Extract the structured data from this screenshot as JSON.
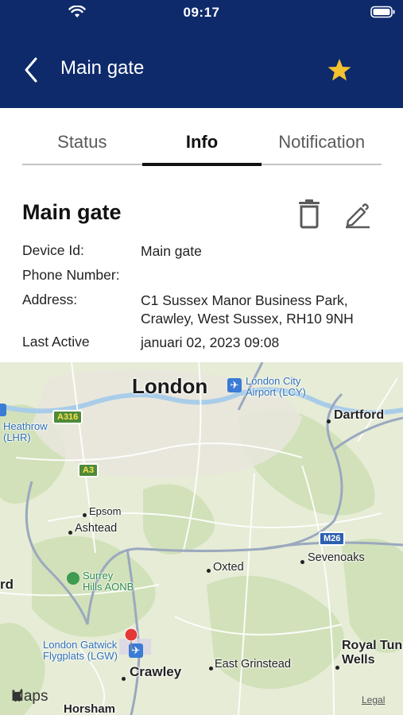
{
  "status_bar": {
    "time": "09:17"
  },
  "nav": {
    "title": "Main gate",
    "favorite_color": "#f2c22f"
  },
  "tabs": [
    {
      "label": "Status",
      "active": false
    },
    {
      "label": "Info",
      "active": true
    },
    {
      "label": "Notification",
      "active": false
    }
  ],
  "device": {
    "title": "Main gate",
    "fields": [
      {
        "label": "Device Id:",
        "value": "Main gate"
      },
      {
        "label": "Phone Number:",
        "value": ""
      },
      {
        "label": "Address:",
        "value_lines": [
          "C1 Sussex Manor Business Park,",
          "Crawley, West Sussex, RH10 9NH"
        ]
      },
      {
        "label": "Last Active",
        "value": "januari 02, 2023 09:08"
      }
    ]
  },
  "map": {
    "labels": {
      "london": "London",
      "london_city_airport": [
        "London City",
        "Airport (LCY)"
      ],
      "heathrow": [
        "Heathrow",
        "(LHR)"
      ],
      "dartford": "Dartford",
      "epsom": "Epsom",
      "ashtead": "Ashtead",
      "surrey_hills": [
        "Surrey",
        "Hills AONB"
      ],
      "oxted": "Oxted",
      "sevenoaks": "Sevenoaks",
      "gatwick": [
        "London Gatwick",
        "Flygplats (LGW)"
      ],
      "crawley": "Crawley",
      "east_grinstead": "East Grinstead",
      "royal_tunbridge": [
        "Royal Tun",
        "Wells"
      ],
      "horsham": "Horsham",
      "edge_left": "rd"
    },
    "shields": {
      "a316": "A316",
      "a3": "A3",
      "m26": "M26"
    },
    "attribution": "Maps",
    "legal": "Legal",
    "pin_color": "#e53935"
  },
  "colors": {
    "header_bg": "#0e2a6b",
    "accent": "#111111"
  }
}
